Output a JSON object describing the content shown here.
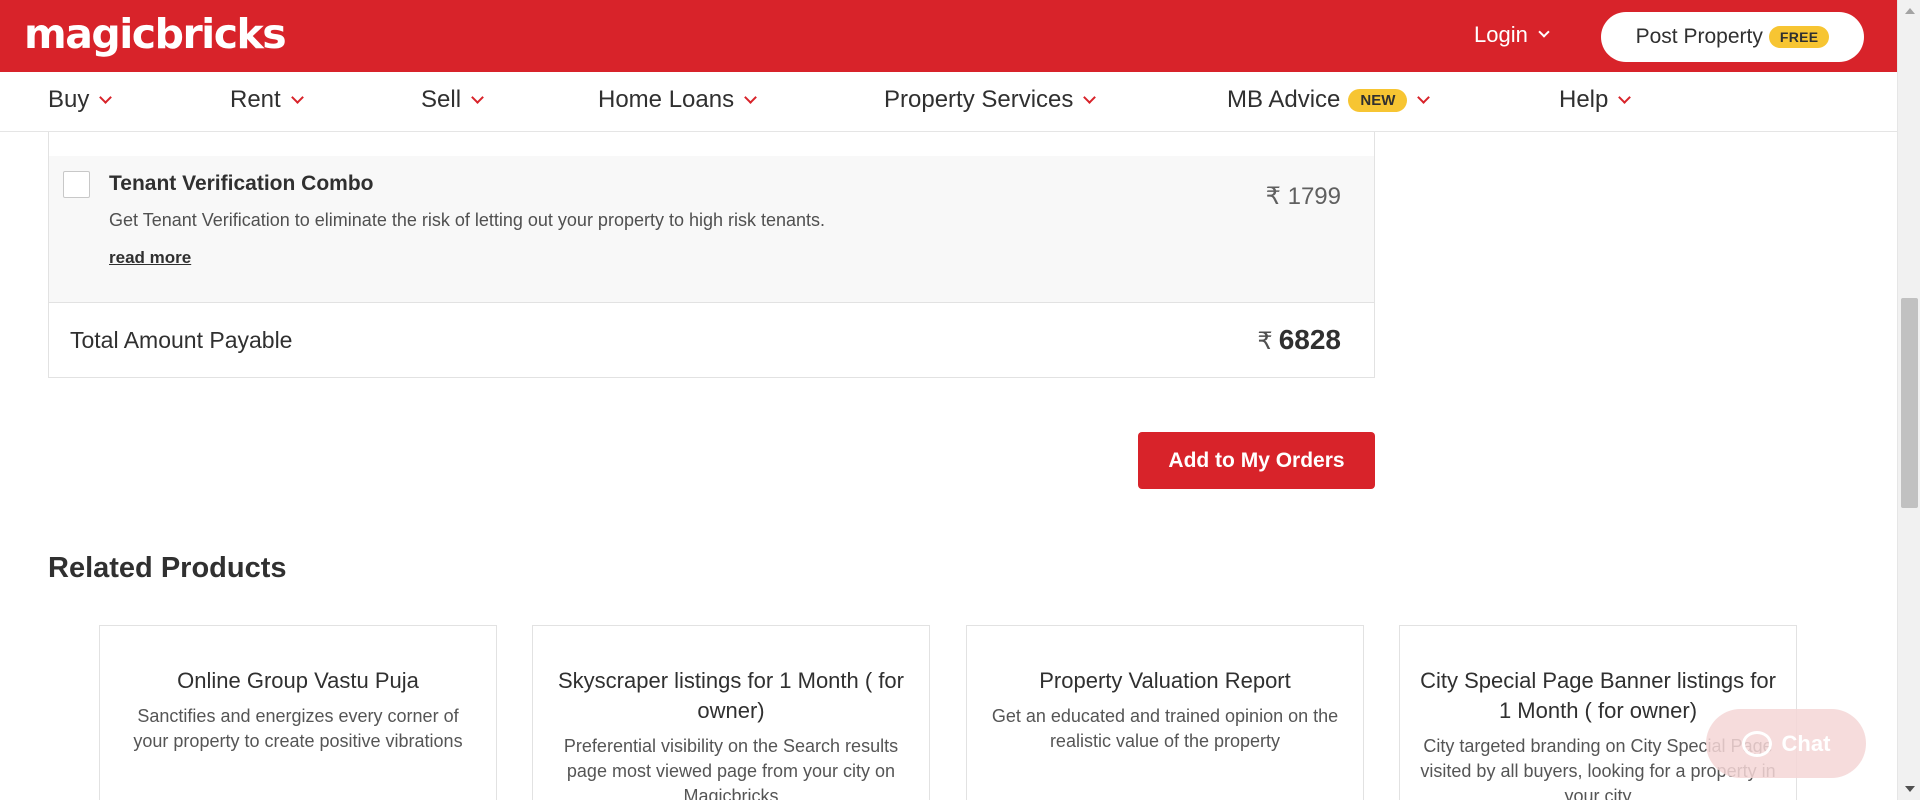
{
  "header": {
    "logo_text": "magicbricks",
    "login_label": "Login",
    "post_property_label": "Post Property",
    "free_badge": "FREE"
  },
  "nav": {
    "items": [
      {
        "label": "Buy"
      },
      {
        "label": "Rent"
      },
      {
        "label": "Sell"
      },
      {
        "label": "Home Loans"
      },
      {
        "label": "Property Services"
      },
      {
        "label": "MB Advice",
        "badge": "NEW"
      },
      {
        "label": "Help"
      }
    ]
  },
  "order": {
    "service": {
      "title": "Tenant Verification Combo",
      "description": "Get Tenant Verification to eliminate the risk of letting out your property to high risk tenants.",
      "read_more": "read more",
      "price": "₹ 1799",
      "checked": false
    },
    "total_label": "Total Amount Payable",
    "total_currency": "₹",
    "total_amount": "6828",
    "add_button": "Add to My Orders"
  },
  "related": {
    "heading": "Related Products",
    "products": [
      {
        "title": "Online Group Vastu Puja",
        "description": "Sanctifies and energizes every corner of your property to create positive vibrations"
      },
      {
        "title": "Skyscraper listings for 1 Month ( for owner)",
        "description": "Preferential visibility on the Search results page most viewed page from your city on Magicbricks"
      },
      {
        "title": "Property Valuation Report",
        "description": "Get an educated and trained opinion on the realistic value of the property"
      },
      {
        "title": "City Special Page Banner listings for 1 Month ( for owner)",
        "description": "City targeted branding on City Special Page visited by all buyers, looking for a property in your city"
      }
    ]
  },
  "chat": {
    "label": "Chat"
  },
  "colors": {
    "brand_red": "#d8232a",
    "badge_yellow": "#f7c532"
  }
}
